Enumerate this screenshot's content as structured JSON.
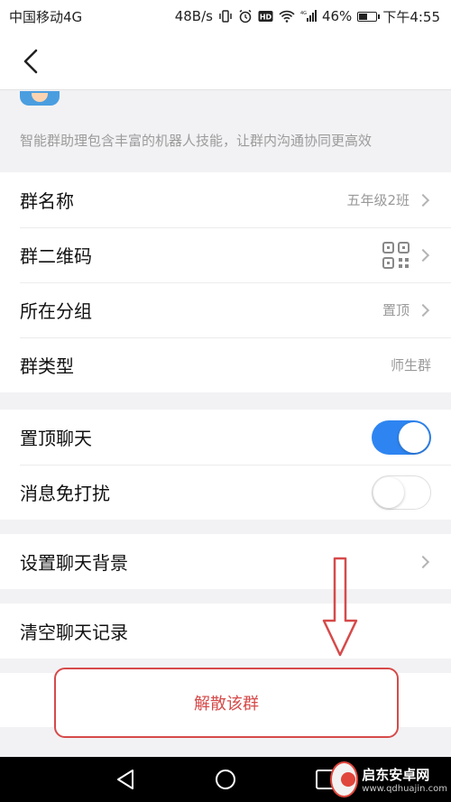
{
  "status_bar": {
    "carrier": "中国移动4G",
    "speed": "48B/s",
    "battery": "46%",
    "battery_level": 0.46,
    "time": "下午4:55"
  },
  "assistant": {
    "description": "智能群助理包含丰富的机器人技能，让群内沟通协同更高效"
  },
  "info_rows": [
    {
      "label": "群名称",
      "value": "五年级2班"
    },
    {
      "label": "群二维码",
      "icon": "qr-code-icon"
    },
    {
      "label": "所在分组",
      "value": "置顶"
    },
    {
      "label": "群类型",
      "value": "师生群"
    }
  ],
  "chat_settings": [
    {
      "label": "置顶聊天",
      "enabled": true
    },
    {
      "label": "消息免打扰",
      "enabled": false
    }
  ],
  "background_row": {
    "label": "设置聊天背景"
  },
  "clear_row": {
    "label": "清空聊天记录"
  },
  "disband_button": {
    "label": "解散该群"
  },
  "watermark": {
    "title": "启东安卓网",
    "url": "www.qdhuajin.com"
  },
  "colors": {
    "accent": "#2e85f1",
    "danger": "#d64a4a"
  }
}
